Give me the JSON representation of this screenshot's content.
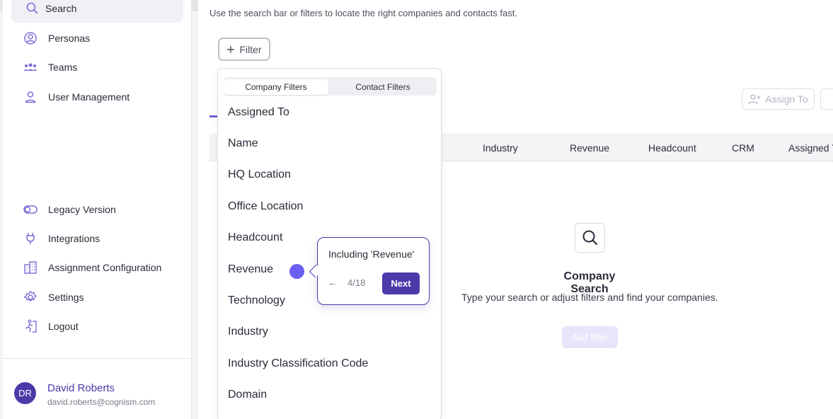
{
  "colors": {
    "accent": "#4b3aa8",
    "beacon": "#6b5ff0"
  },
  "sidebar": {
    "active_item": {
      "label": "Search",
      "icon": "search-icon"
    },
    "top_items": [
      {
        "label": "Personas",
        "icon": "persona-icon"
      },
      {
        "label": "Teams",
        "icon": "teams-icon"
      },
      {
        "label": "User Management",
        "icon": "user-icon"
      }
    ],
    "bottom_items": [
      {
        "label": "Legacy Version",
        "icon": "toggle-icon"
      },
      {
        "label": "Integrations",
        "icon": "plug-icon"
      },
      {
        "label": "Assignment Configuration",
        "icon": "building-icon"
      },
      {
        "label": "Settings",
        "icon": "gear-icon"
      },
      {
        "label": "Logout",
        "icon": "logout-icon"
      }
    ],
    "user": {
      "initials": "DR",
      "name": "David Roberts",
      "email": "david.roberts@cognism.com"
    }
  },
  "main": {
    "subtitle": "Use the search bar or filters to locate the right companies and contacts fast.",
    "filter_button": "Filter",
    "assign_button": "Assign To",
    "columns": [
      "Industry",
      "Revenue",
      "Headcount",
      "CRM",
      "Assigned To"
    ],
    "empty_state": {
      "title": "Company Search",
      "description": "Type your search or adjust filters and find your companies.",
      "button": "Add filter"
    }
  },
  "dropdown": {
    "tabs": [
      "Company Filters",
      "Contact Filters"
    ],
    "items": [
      "Assigned To",
      "Name",
      "HQ Location",
      "Office Location",
      "Headcount",
      "Revenue",
      "Technology",
      "Industry",
      "Industry Classification Code",
      "Domain"
    ]
  },
  "tour": {
    "text": "Including 'Revenue'",
    "back": "←",
    "step": "4/18",
    "next": "Next"
  }
}
